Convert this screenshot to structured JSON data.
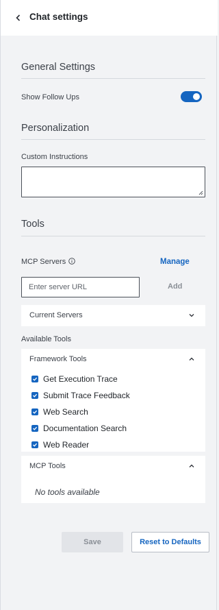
{
  "header": {
    "title": "Chat settings"
  },
  "general": {
    "title": "General Settings",
    "show_follow_ups_label": "Show Follow Ups",
    "show_follow_ups_enabled": true
  },
  "personalization": {
    "title": "Personalization",
    "custom_instructions_label": "Custom Instructions",
    "custom_instructions_value": ""
  },
  "tools": {
    "title": "Tools",
    "mcp_servers_label": "MCP Servers",
    "manage_label": "Manage",
    "server_url_placeholder": "Enter server URL",
    "add_label": "Add",
    "current_servers_label": "Current Servers",
    "available_tools_label": "Available Tools",
    "framework_tools": {
      "title": "Framework Tools",
      "items": [
        {
          "label": "Get Execution Trace",
          "checked": true
        },
        {
          "label": "Submit Trace Feedback",
          "checked": true
        },
        {
          "label": "Web Search",
          "checked": true
        },
        {
          "label": "Documentation Search",
          "checked": true
        },
        {
          "label": "Web Reader",
          "checked": true
        }
      ]
    },
    "mcp_tools": {
      "title": "MCP Tools",
      "empty_text": "No tools available"
    }
  },
  "actions": {
    "save_label": "Save",
    "reset_label": "Reset to Defaults"
  },
  "colors": {
    "accent": "#1565c0",
    "background": "#f2f3f5",
    "card": "#ffffff"
  }
}
